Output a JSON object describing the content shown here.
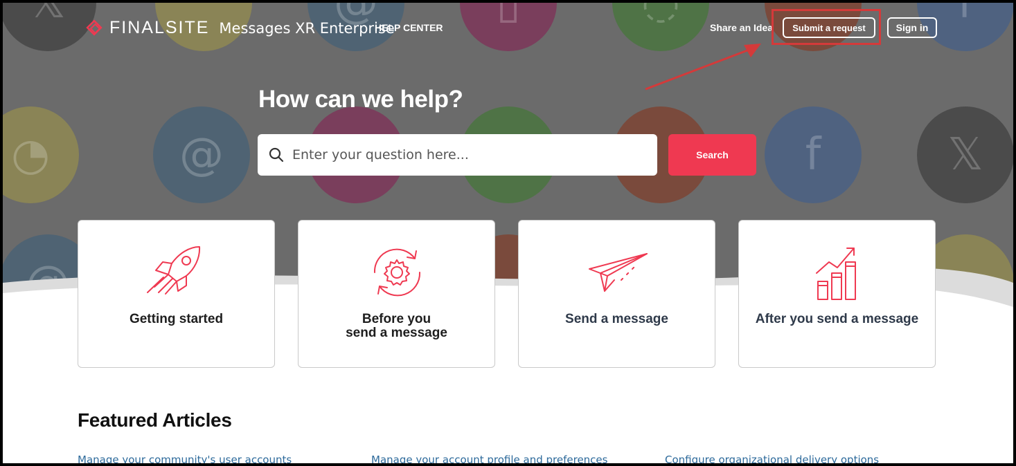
{
  "header": {
    "brand": "FINALSITE",
    "product": "Messages XR Enterprise",
    "help_center": "HELP CENTER",
    "share_idea": "Share an Idea",
    "submit_request": "Submit a request",
    "sign_in": "Sign in"
  },
  "hero": {
    "title": "How can we help?",
    "search_placeholder": "Enter your question here...",
    "search_button": "Search"
  },
  "categories": [
    {
      "label": "Getting started",
      "icon": "rocket-icon"
    },
    {
      "label_line1": "Before you",
      "label_line2": "send a message",
      "icon": "gear-cycle-icon"
    },
    {
      "label": "Send a message",
      "icon": "paper-plane-icon"
    },
    {
      "label": "After you send a message",
      "icon": "growth-chart-icon"
    }
  ],
  "featured": {
    "title": "Featured Articles",
    "articles": [
      "Manage your community's user accounts",
      "Manage your account profile and preferences",
      "Configure organizational delivery options"
    ]
  },
  "colors": {
    "accent": "#ef3951",
    "hero_overlay": "#6b6b6b",
    "annotation": "#d43a3a",
    "link": "#2d6a9b"
  }
}
